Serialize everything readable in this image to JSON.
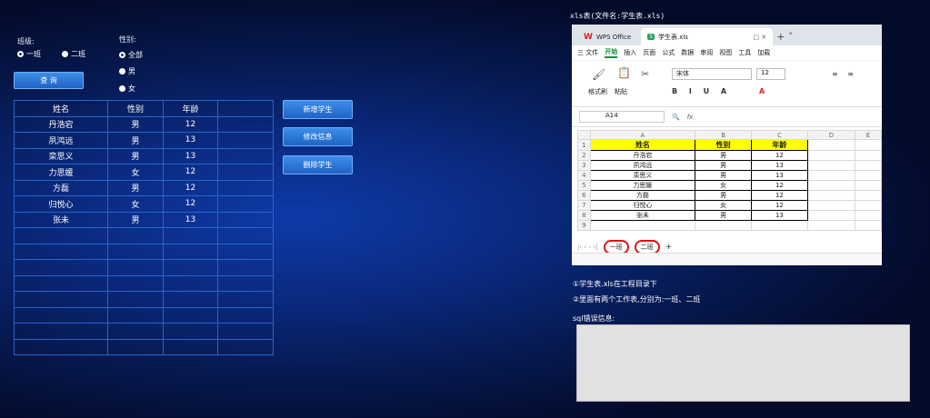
{
  "form": {
    "class_label": "班级:",
    "gender_label": "性别:",
    "class_options": [
      "一班",
      "二班"
    ],
    "class_selected": "一班",
    "gender_options": [
      "全部",
      "男",
      "女"
    ],
    "gender_selected": "全部",
    "query_button": "查 询"
  },
  "table": {
    "headers": [
      "姓名",
      "性别",
      "年龄"
    ],
    "rows": [
      [
        "丹浩宕",
        "男",
        "12"
      ],
      [
        "夙鸿远",
        "男",
        "13"
      ],
      [
        "栾思义",
        "男",
        "13"
      ],
      [
        "力思媛",
        "女",
        "12"
      ],
      [
        "方磊",
        "男",
        "12"
      ],
      [
        "归悦心",
        "女",
        "12"
      ],
      [
        "张未",
        "男",
        "13"
      ]
    ]
  },
  "actions": {
    "add": "新增学生",
    "edit": "修改信息",
    "delete": "删除学生"
  },
  "excel": {
    "caption": "xls表(文件名:学生表.xls)",
    "tab_wps": "WPS Office",
    "tab_file": "学生表.xls",
    "menu": [
      "三 文件",
      "开始",
      "插入",
      "页面",
      "公式",
      "数据",
      "审阅",
      "视图",
      "工具",
      "加载"
    ],
    "menu_active": "开始",
    "font_name": "宋体",
    "font_size": "12",
    "cell_ref": "A14",
    "fx": "fx",
    "ribbon_labels": {
      "format_painter": "格式刷",
      "paste": "粘贴"
    },
    "col_headers": [
      "A",
      "B",
      "C",
      "D",
      "E"
    ],
    "sheet_headers": [
      "姓名",
      "性别",
      "年龄"
    ],
    "sheet_rows": [
      [
        "丹浩宕",
        "男",
        "12"
      ],
      [
        "夙鸿远",
        "男",
        "13"
      ],
      [
        "栾思义",
        "男",
        "13"
      ],
      [
        "力思媛",
        "女",
        "12"
      ],
      [
        "方磊",
        "男",
        "12"
      ],
      [
        "归悦心",
        "女",
        "12"
      ],
      [
        "张未",
        "男",
        "13"
      ]
    ],
    "sheet_tabs": [
      "一班",
      "二班"
    ]
  },
  "notes": {
    "n1": "①学生表.xls在工程目录下",
    "n2": "②里面有两个工作表,分别为:一班、二班",
    "sql_label": "sql错误信息:"
  },
  "colors": {
    "accent": "#1f63c4",
    "highlight": "#ffff00",
    "wps_red": "#e02020",
    "wps_green": "#1fa35c"
  }
}
